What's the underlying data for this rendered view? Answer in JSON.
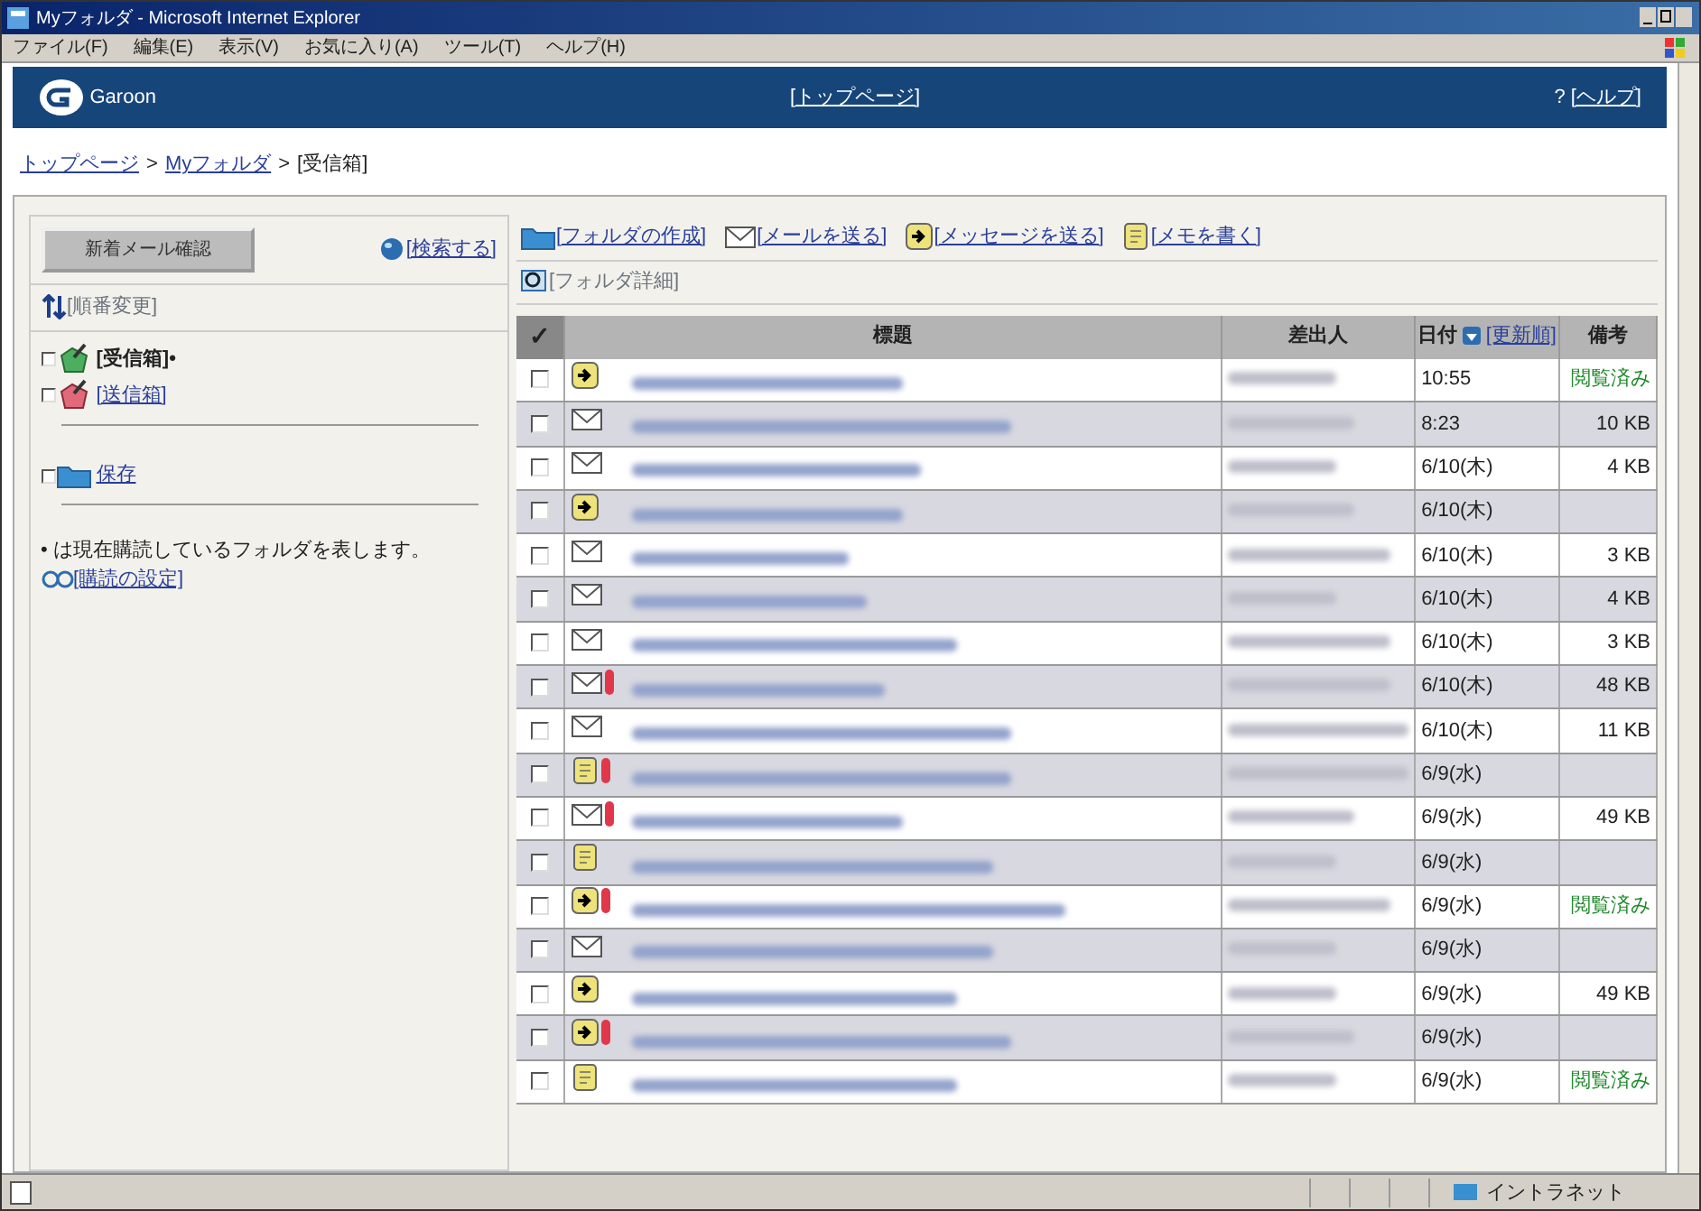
{
  "window": {
    "title": "Myフォルダ - Microsoft Internet Explorer"
  },
  "menu": [
    "ファイル(F)",
    "編集(E)",
    "表示(V)",
    "お気に入り(A)",
    "ツール(T)",
    "ヘルプ(H)"
  ],
  "header": {
    "logo": "Garoon",
    "top_link": "[トップページ]",
    "help_mark": "?",
    "help_link": "[ヘルプ]"
  },
  "breadcrumb": {
    "separator": ">",
    "items": [
      {
        "text": "トップページ",
        "link": true
      },
      {
        "text": "Myフォルダ",
        "link": true
      },
      {
        "text": "[受信箱]",
        "link": false
      }
    ]
  },
  "sidebar": {
    "check_button": "新着メール確認",
    "search_link": "[検索する]",
    "reorder_link": "[順番変更]",
    "folders": [
      {
        "label": "[受信箱]•",
        "kind": "inbox",
        "selected": true
      },
      {
        "label": "[送信箱]",
        "kind": "outbox",
        "selected": false
      },
      {
        "label": "保存",
        "kind": "folder",
        "selected": false
      }
    ],
    "note": "• は現在購読しているフォルダを表します。",
    "subscribe_link": "[購読の設定]"
  },
  "toolbar": {
    "actions": [
      {
        "label": "[フォルダの作成]",
        "kind": "folder"
      },
      {
        "label": "[メールを送る]",
        "kind": "mail"
      },
      {
        "label": "[メッセージを送る]",
        "kind": "message"
      },
      {
        "label": "[メモを書く]",
        "kind": "memo"
      }
    ],
    "detail_link": "[フォルダ詳細]"
  },
  "table": {
    "check_all": "✓",
    "columns": {
      "subject": "標題",
      "sender": "差出人",
      "date": "日付",
      "sort_link": "[更新順]",
      "note": "備考"
    },
    "rows": [
      {
        "kind": "message",
        "attachment": false,
        "checked": false,
        "date": "10:55",
        "note": "閲覧済み"
      },
      {
        "kind": "mail",
        "attachment": false,
        "checked": false,
        "date": "8:23",
        "note": "10 KB"
      },
      {
        "kind": "mail",
        "attachment": false,
        "checked": false,
        "date": "6/10(木)",
        "note": "4 KB"
      },
      {
        "kind": "message",
        "attachment": false,
        "checked": false,
        "date": "6/10(木)"
      },
      {
        "kind": "mail",
        "attachment": false,
        "checked": false,
        "date": "6/10(木)",
        "note": "3 KB"
      },
      {
        "kind": "mail",
        "attachment": false,
        "checked": false,
        "date": "6/10(木)",
        "note": "4 KB"
      },
      {
        "kind": "mail",
        "attachment": false,
        "checked": false,
        "date": "6/10(木)",
        "note": "3 KB"
      },
      {
        "kind": "mail",
        "attachment": true,
        "checked": false,
        "date": "6/10(木)",
        "note": "48 KB"
      },
      {
        "kind": "mail",
        "attachment": false,
        "checked": false,
        "date": "6/10(木)",
        "note": "11 KB"
      },
      {
        "kind": "memo",
        "attachment": true,
        "checked": false,
        "date": "6/9(水)"
      },
      {
        "kind": "mail",
        "attachment": true,
        "checked": false,
        "date": "6/9(水)",
        "note": "49 KB"
      },
      {
        "kind": "memo",
        "attachment": false,
        "checked": false,
        "date": "6/9(水)"
      },
      {
        "kind": "message",
        "attachment": true,
        "checked": false,
        "date": "6/9(水)",
        "note": "閲覧済み"
      },
      {
        "kind": "mail",
        "attachment": false,
        "checked": false,
        "date": "6/9(水)"
      },
      {
        "kind": "message",
        "attachment": false,
        "checked": false,
        "date": "6/9(水)",
        "note": "49 KB"
      },
      {
        "kind": "message",
        "attachment": true,
        "checked": false,
        "date": "6/9(水)"
      },
      {
        "kind": "memo",
        "attachment": false,
        "checked": false,
        "date": "6/9(水)",
        "note": "閲覧済み"
      }
    ]
  },
  "status_bar": {
    "zone": "イントラネット"
  }
}
